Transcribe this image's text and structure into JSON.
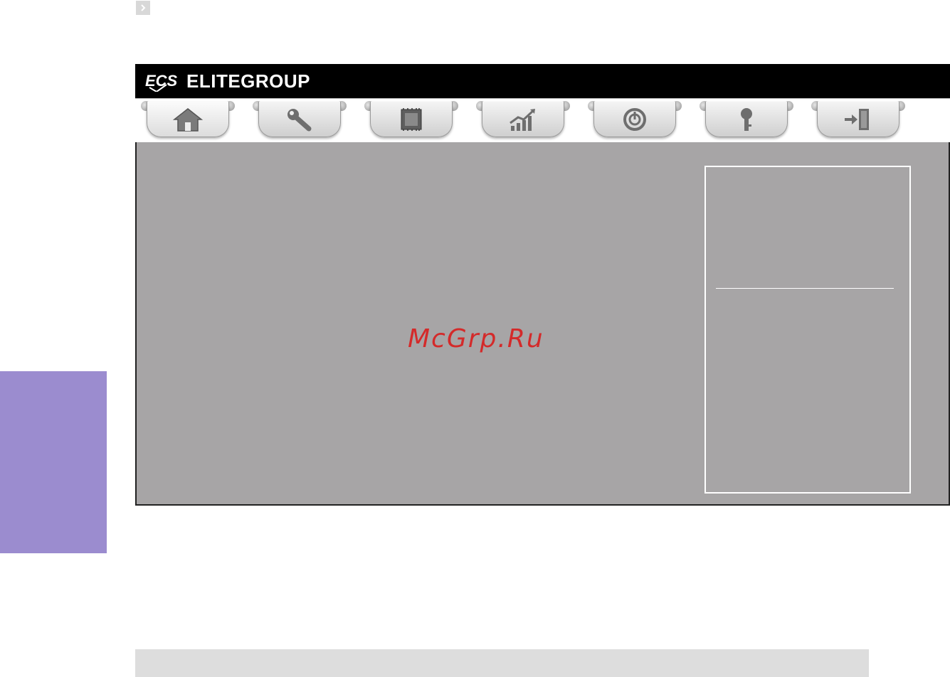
{
  "header": {
    "brand": "ELITEGROUP",
    "logo": "ECS"
  },
  "tabs": [
    {
      "icon": "home-icon",
      "active": true
    },
    {
      "icon": "wrench-icon",
      "active": false
    },
    {
      "icon": "chip-icon",
      "active": false
    },
    {
      "icon": "chart-up-icon",
      "active": false
    },
    {
      "icon": "power-icon",
      "active": false
    },
    {
      "icon": "key-icon",
      "active": false
    },
    {
      "icon": "exit-icon",
      "active": false
    }
  ],
  "watermark": "McGrp.Ru",
  "colors": {
    "side_tab": "#9b8ccf",
    "content_bg": "#a7a5a6",
    "watermark": "#d42a2a"
  }
}
